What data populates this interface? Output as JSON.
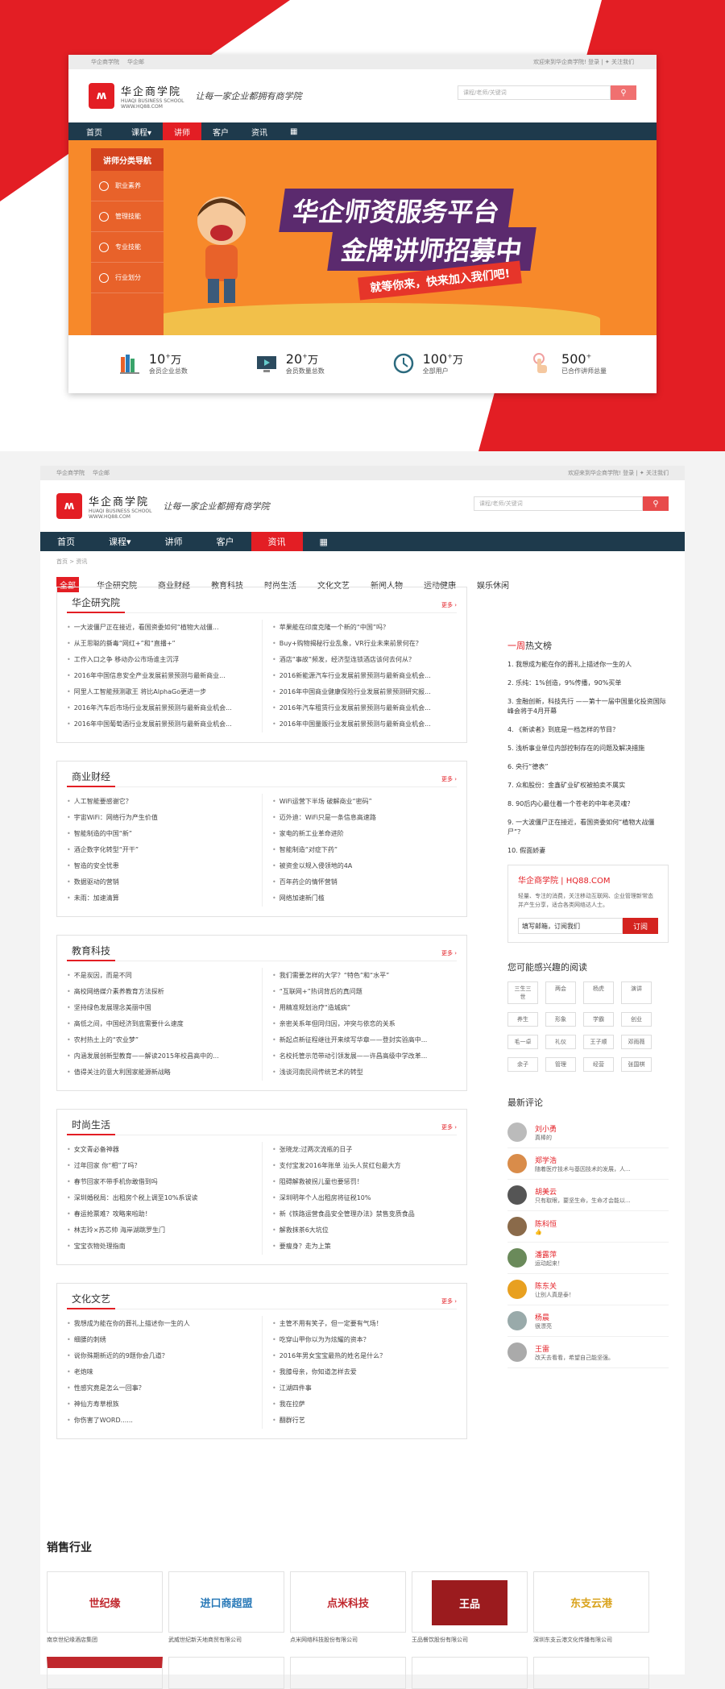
{
  "top_card": {
    "topbar_left": [
      "华企商学院",
      "华企邮"
    ],
    "topbar_right": "欢迎来到华企商学院!  登录 |  ✦ 关注我们",
    "logo_cn": "华企商学院",
    "logo_en": "HUAQI BUSINESS SCHOOL",
    "logo_url": "WWW.HQ88.COM",
    "slogan": "让每一家企业都拥有商学院",
    "search_placeholder": "课程/老师/关键词",
    "nav": [
      "首页",
      "课程▾",
      "讲师",
      "客户",
      "资讯",
      "▦"
    ],
    "nav_active": 2,
    "banner": {
      "cat_title": "讲师分类导航",
      "cats": [
        "职业素养",
        "管理技能",
        "专业技能",
        "行业划分"
      ],
      "title1": "华企师资服务平台",
      "title2": "金牌讲师招募中",
      "title3": "就等你来，快来加入我们吧!"
    },
    "stats": [
      {
        "num": "10",
        "unit": "万",
        "label": "会员企业总数"
      },
      {
        "num": "20",
        "unit": "万",
        "label": "会员数量总数"
      },
      {
        "num": "100",
        "unit": "万",
        "label": "全部用户"
      },
      {
        "num": "500",
        "unit": "",
        "label": "已合作讲师总量"
      }
    ]
  },
  "page2": {
    "topbar_left": [
      "华企商学院",
      "华企邮"
    ],
    "topbar_right": "欢迎来到华企商学院!  登录 |  ✦ 关注我们",
    "nav": [
      "首页",
      "课程▾",
      "讲师",
      "客户",
      "资讯",
      "▦"
    ],
    "nav_active": 4,
    "breadcrumb": "首页 > 资讯",
    "tabs": [
      "全部",
      "华企研究院",
      "商业财经",
      "教育科技",
      "时尚生活",
      "文化文艺",
      "新闻人物",
      "运动健康",
      "娱乐休闲"
    ],
    "more": "更多 ›",
    "sections": [
      {
        "title": "华企研究院",
        "left": [
          "一大波僵尸正在接近，看国资委如何“植物大战僵...",
          "从王思聪的撕毒“网红+”和“直播+”",
          "工作入口之争 移动办公市场谁主沉浮",
          "2016年中国信息安全产业发展前景预测与最新商业...",
          "阿里人工智能预测歌王 将比AlphaGo更进一步",
          "2016年汽车后市场行业发展前景预测与最新商业机会...",
          "2016年中国葡萄酒行业发展前景预测与最新商业机会..."
        ],
        "right": [
          "苹果能在印度克隆一个新的“中国”吗？",
          "Buy+购物揭秘行业乱象，VR行业未来前景何在？",
          "酒店“事故”频发，经济型连锁酒店该何去何从？",
          "2016新能源汽车行业发展前景预测与最新商业机会...",
          "2016年中国商业健康保险行业发展前景预测研究报...",
          "2016年汽车租赁行业发展前景预测与最新商业机会...",
          "2016年中国量贩行业发展前景预测与最新商业机会..."
        ]
      },
      {
        "title": "商业财经",
        "left": [
          "人工智能要感谢它？",
          "宇宙WiFi：网络行为产生价值",
          "智能制造的中国“新”",
          "酒企数字化转型“开干”",
          "智造的安全忧患",
          "数据驱动的营销",
          "未雨：加速清算"
        ],
        "right": [
          "WiFi运营下半场 破解商业“密码”",
          "迈外迪：WiFi只是一条信息高速路",
          "家电的新工业革命进阶",
          "智能制造“对症下药”",
          "被资金以规入侵领地的4A",
          "百年药企的情怀营销",
          "网络加速新门槛"
        ]
      },
      {
        "title": "教育科技",
        "left": [
          "不是炭因，而是不同",
          "高校网络媒介素养教育方法探析",
          "坚持绿色发展理念美丽中国",
          "高低之间，中国经济到底需要什么速度",
          "农村热土上的“农业梦”",
          "内涵发展创新型教育——解读2015年校昌高中的...",
          "值得关注的意大利国家能源新战略"
        ],
        "right": [
          "我们需要怎样的大学？“特色”和“水平”",
          "“互联网+”热词背后的真问题",
          "用精准规划治疗“造城病”",
          "亲密关系年但同归因，冲突与依恋的关系",
          "新起点新征程继往开来续写华章——登封实验高中...",
          "名校托管示范带动引领发展——许昌高级中学改革...",
          "浅谈河南民间传统艺术的转型"
        ]
      },
      {
        "title": "时尚生活",
        "left": [
          "女文青必备神器",
          "过年回家 你“相”了吗？",
          "春节回家不带手机你敢借到吗",
          "深圳婚税局：出租房个税上调至10%系误读",
          "春运抢票难？攻略来啦助！",
          "林志玲×苏芯帅 海岸湖跳罗生门",
          "宝宝衣物处理指南"
        ],
        "right": [
          "张晓龙:过两次流瓶的日子",
          "支付宝发2016年账单 汕头人贫红包最大方",
          "阻碍解救被拐儿童也要惩罚！",
          "深圳明年个人出租房将征税10%",
          "新《铁路运营食品安全管理办法》禁售变质食品",
          "解救抹茶6大坑位",
          "要瘦身？走为上策"
        ]
      },
      {
        "title": "文化文艺",
        "left": [
          "我想成为能在你的葬礼上描述你一生的人",
          "细腰的刺绣",
          "说你殊期新近的的9题你会几道？",
          "老炮味",
          "性感究竟是怎么一回事？",
          "神仙方寿草根族",
          "你伤害了WORD......"
        ],
        "right": [
          "主管不用有笑子，但一定要有气场！",
          "吃穿山甲你以为为炫耀的资本？",
          "2016年男女宝宝最热的姓名是什么？",
          "我膝母亲，你知道怎样去爱",
          "江湖四件事",
          "我在拉萨",
          "翻群行艺"
        ]
      }
    ],
    "hot_title_red": "一周",
    "hot_title_rest": "热文榜",
    "hot": [
      "1. 我想成为能在你的葬礼上描述你一生的人",
      "2. 乐纯：1%创造，9%传播，90%买单",
      "3. 金融创新，科技先行 ——第十一届中国量化投资国际峰会将于4月开幕",
      "4. 《新读者》到底是一档怎样的节目？",
      "5. 浅析事业单位内部控制存在的问题及解决措施",
      "6. 央行“德表”",
      "7. 众和股份：金鑫矿业矿权被拍卖不属实",
      "8. 90后内心最住着一个苍老的中年老灵魂？",
      "9. 一大波僵尸正在接近，看国资委如何“植物大战僵尸”？",
      "10. 假面娇妻"
    ],
    "subscribe": {
      "title": "华企商学院 | HQ88.COM",
      "desc": "轻量、专注的消费，关注移动互联网、企业管理新常态并产生分享，适合各类网络达人士。",
      "input": "填写邮箱，订阅我们",
      "button": "订阅"
    },
    "tags_title": "您可能感兴趣的阅读",
    "tags": [
      "三生三世",
      "两会",
      "杨虎",
      "演讲",
      "养生",
      "形象",
      "学霸",
      "创业",
      "毛一卓",
      "礼仪",
      "王子顺",
      "邓雨薇",
      "余子",
      "管理",
      "经营",
      "张国棋"
    ],
    "comments_title": "最新评论",
    "comments": [
      {
        "name": "刘小勇",
        "text": "真棒的"
      },
      {
        "name": "郑学浩",
        "text": "随着医疗技术与基因技术的发展，人..."
      },
      {
        "name": "胡美云",
        "text": "只有取眼，要坚生命，生命才会能以..."
      },
      {
        "name": "陈科恒",
        "text": "👍"
      },
      {
        "name": "潘露萍",
        "text": "运动起来！"
      },
      {
        "name": "陈东关",
        "text": "让别人真是泰！"
      },
      {
        "name": "杨晨",
        "text": "很漂亮"
      },
      {
        "name": "王雷",
        "text": "改天去看看，希望自己能坚强。"
      }
    ],
    "sales_title": "销售行业",
    "logos": [
      {
        "mark": "世纪缘",
        "color": "#c0272d",
        "caption": "南京世纪缘酒店集团"
      },
      {
        "mark": "进口商超盟",
        "color": "#2a7ab8",
        "caption": "武威世纪新天地商贸有限公司"
      },
      {
        "mark": "点米科技",
        "color": "#c0272d",
        "caption": "点米网络科技股份有限公司"
      },
      {
        "mark": "王品",
        "color": "#9b1b1e",
        "caption": "王品餐饮股份有限公司"
      },
      {
        "mark": "东支云港",
        "color": "#d9a21b",
        "caption": "深圳东支云港文化传播有限公司"
      }
    ]
  }
}
